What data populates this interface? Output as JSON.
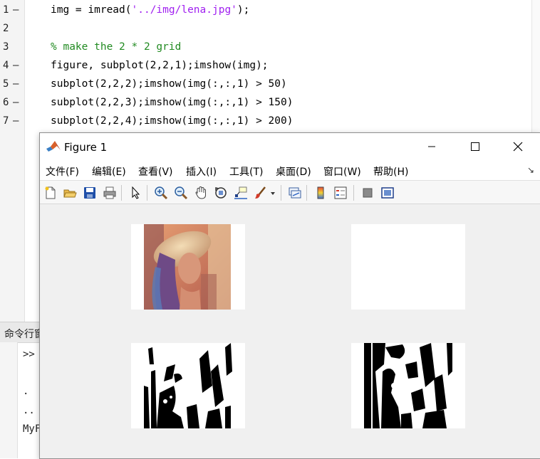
{
  "editor": {
    "lines": [
      {
        "num": "1",
        "dash": "—",
        "code": "img = imread(",
        "str": "'../img/lena.jpg'",
        "tail": ");"
      },
      {
        "num": "2",
        "dash": "",
        "code": "",
        "str": "",
        "tail": ""
      },
      {
        "num": "3",
        "dash": "",
        "comment": "% make the 2 * 2 grid"
      },
      {
        "num": "4",
        "dash": "—",
        "code": "figure, subplot(2,2,1);imshow(img);"
      },
      {
        "num": "5",
        "dash": "—",
        "code": "subplot(2,2,2);imshow(img(:,:,1) > 50)"
      },
      {
        "num": "6",
        "dash": "—",
        "code": "subplot(2,2,3);imshow(img(:,:,1) > 150)"
      },
      {
        "num": "7",
        "dash": "—",
        "code": "subplot(2,2,4);imshow(img(:,:,1) > 200)"
      }
    ]
  },
  "command_window": {
    "title": "命令行窗口",
    "prompt": ">>",
    "line1": ".",
    "line2": "..",
    "line3": "MyFi"
  },
  "figure": {
    "title": "Figure 1",
    "menus": [
      "文件(F)",
      "编辑(E)",
      "查看(V)",
      "插入(I)",
      "工具(T)",
      "桌面(D)",
      "窗口(W)",
      "帮助(H)"
    ],
    "toolbar_icons": [
      "new-figure-icon",
      "open-file-icon",
      "save-icon",
      "print-icon",
      "select-arrow-icon",
      "zoom-in-icon",
      "zoom-out-icon",
      "pan-hand-icon",
      "rotate-3d-icon",
      "data-cursor-icon",
      "brush-icon",
      "brush-dropdown-icon",
      "link-plot-icon",
      "colorbar-icon",
      "legend-icon",
      "hide-plot-tools-icon",
      "show-plot-tools-icon"
    ],
    "subplots": [
      {
        "name": "subplot-1-original",
        "content": "Color photo (lena)"
      },
      {
        "name": "subplot-2-threshold-50",
        "content": "Binary mask (red > 50)"
      },
      {
        "name": "subplot-3-threshold-150",
        "content": "Binary mask (red > 150)"
      },
      {
        "name": "subplot-4-threshold-200",
        "content": "Binary mask (red > 200)"
      }
    ]
  },
  "colors": {
    "string": "#a020f0",
    "comment": "#228b22",
    "save_blue": "#1f4fa8"
  }
}
